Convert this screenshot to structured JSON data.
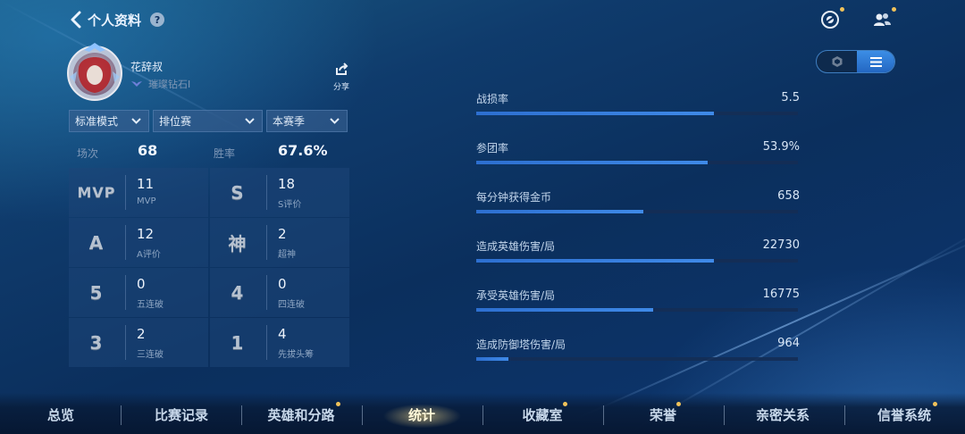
{
  "header": {
    "title": "个人资料",
    "help_glyph": "?"
  },
  "profile": {
    "name": "花辞叔",
    "rank": "璀璨钻石I",
    "share_label": "分享"
  },
  "filters": [
    {
      "label": "标准模式"
    },
    {
      "label": "排位赛"
    },
    {
      "label": "本赛季"
    }
  ],
  "summary": {
    "matches_label": "场次",
    "matches_value": "68",
    "winrate_label": "胜率",
    "winrate_value": "67.6%"
  },
  "stats": [
    {
      "badge": "MVP",
      "value": "11",
      "label": "MVP"
    },
    {
      "badge": "S",
      "value": "18",
      "label": "S评价"
    },
    {
      "badge": "A",
      "value": "12",
      "label": "A评价"
    },
    {
      "badge": "神",
      "value": "2",
      "label": "超神"
    },
    {
      "badge": "5",
      "value": "0",
      "label": "五连破"
    },
    {
      "badge": "4",
      "value": "0",
      "label": "四连破"
    },
    {
      "badge": "3",
      "value": "2",
      "label": "三连破"
    },
    {
      "badge": "1",
      "value": "4",
      "label": "先拔头筹"
    }
  ],
  "performance": [
    {
      "label": "战损率",
      "value": "5.5",
      "fill": 0.74
    },
    {
      "label": "参团率",
      "value": "53.9%",
      "fill": 0.72
    },
    {
      "label": "每分钟获得金币",
      "value": "658",
      "fill": 0.52
    },
    {
      "label": "造成英雄伤害/局",
      "value": "22730",
      "fill": 0.74
    },
    {
      "label": "承受英雄伤害/局",
      "value": "16775",
      "fill": 0.55
    },
    {
      "label": "造成防御塔伤害/局",
      "value": "964",
      "fill": 0.1
    }
  ],
  "nav": [
    {
      "label": "总览",
      "dot": false,
      "active": false
    },
    {
      "label": "比赛记录",
      "dot": false,
      "active": false
    },
    {
      "label": "英雄和分路",
      "dot": true,
      "active": false
    },
    {
      "label": "统计",
      "dot": false,
      "active": true
    },
    {
      "label": "收藏室",
      "dot": true,
      "active": false
    },
    {
      "label": "荣誉",
      "dot": true,
      "active": false
    },
    {
      "label": "亲密关系",
      "dot": false,
      "active": false
    },
    {
      "label": "信誉系统",
      "dot": true,
      "active": false
    }
  ],
  "colors": {
    "accent": "#3f8ae8",
    "notification_dot": "#f0c25a",
    "background": "#0b2f5d"
  },
  "icons": [
    "back-arrow-icon",
    "help-icon",
    "emblem-icon",
    "friends-icon",
    "share-icon",
    "rank-wings-icon",
    "chevron-down-icon",
    "hexagon-icon",
    "list-icon"
  ]
}
